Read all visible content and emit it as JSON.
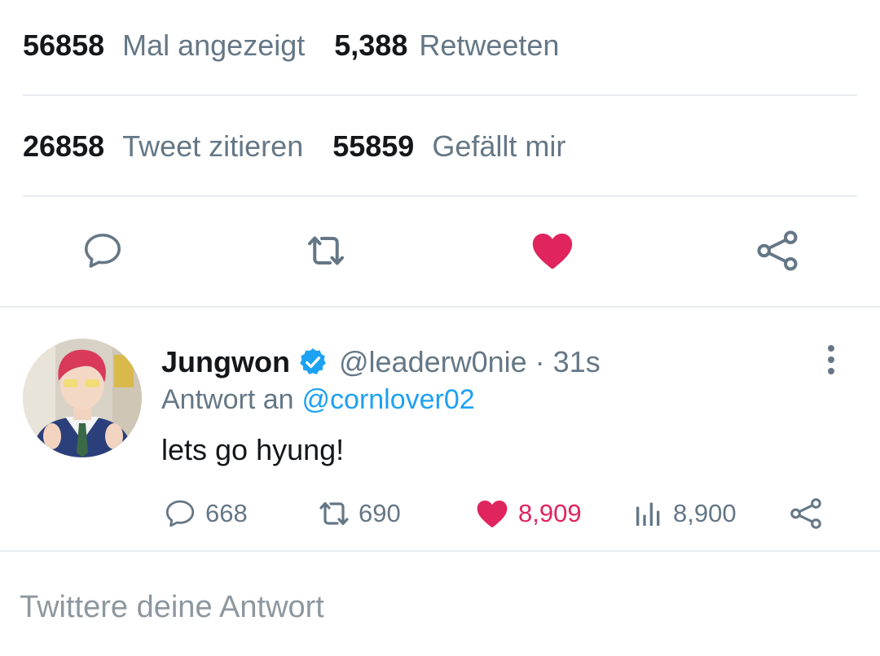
{
  "stats": {
    "views_count": "56858",
    "views_label": "Mal angezeigt",
    "retweets_count": "5,388",
    "retweets_label": "Retweeten",
    "quotes_count": "26858",
    "quotes_label": "Tweet zitieren",
    "likes_count": "55859",
    "likes_label": "Gefällt mir"
  },
  "actions": {
    "reply_icon": "speech-bubble-icon",
    "retweet_icon": "retweet-icon",
    "like_icon": "heart-icon",
    "share_icon": "share-icon",
    "like_active": true
  },
  "reply": {
    "author": "Jungwon",
    "handle": "@leaderw0nie · 31s",
    "reply_to_prefix": "Antwort an",
    "reply_to_handle": "@cornlover02",
    "text": "lets go hyung!",
    "counts": {
      "replies": "668",
      "retweets": "690",
      "likes": "8,909",
      "views": "8,900"
    }
  },
  "compose": {
    "placeholder": "Twittere deine Antwort"
  },
  "colors": {
    "like": "#e0245e",
    "link": "#1da1f2",
    "secondary_text": "#657786",
    "divider": "#e6ecf0"
  }
}
